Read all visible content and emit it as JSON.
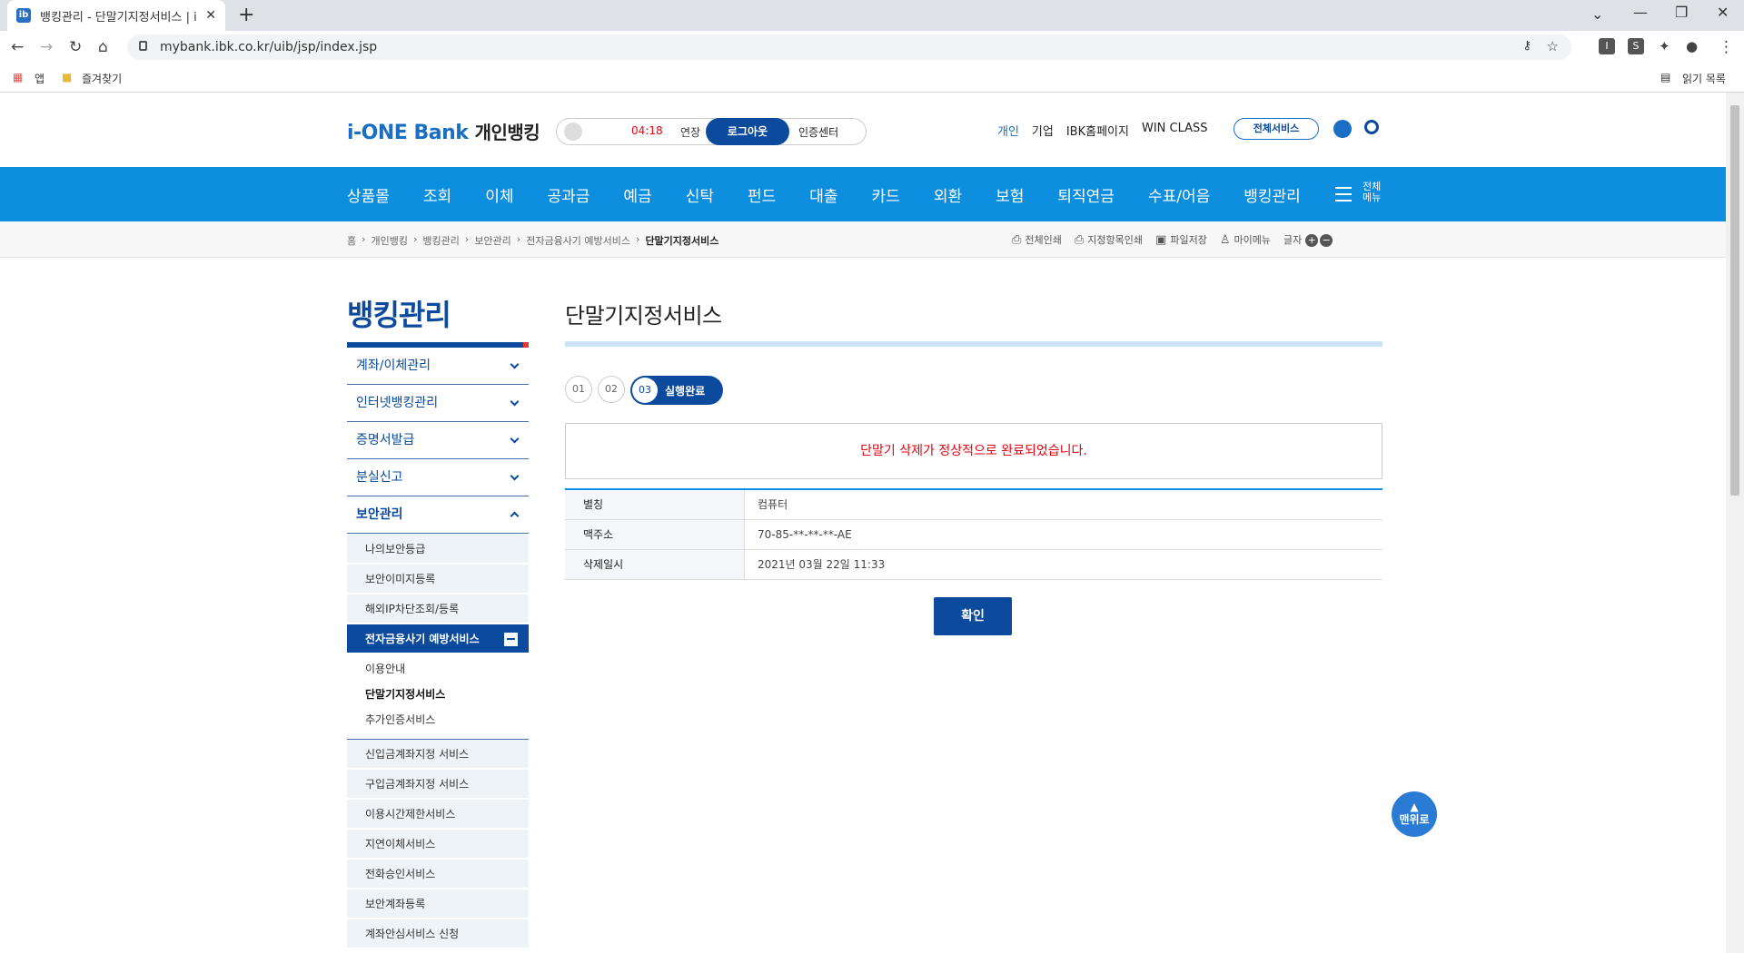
{
  "browser": {
    "tab_title": "뱅킹관리 - 단말기지정서비스 | i",
    "url": "mybank.ibk.co.kr/uib/jsp/index.jsp",
    "bookmarks": [
      "앱",
      "즐겨찾기"
    ],
    "reading_list": "읽기 목록",
    "ext_labels": [
      "I",
      "S"
    ]
  },
  "header": {
    "logo_brand": "i-ONE Bank",
    "logo_sub": "개인뱅킹",
    "timer": "04:18",
    "extend": "연장",
    "logout": "로그아웃",
    "cert_center": "인증센터",
    "top_nav": [
      "개인",
      "기업",
      "IBK홈페이지",
      "WIN CLASS"
    ],
    "all_services": "전체서비스"
  },
  "gnb": {
    "items": [
      "상품몰",
      "조회",
      "이체",
      "공과금",
      "예금",
      "신탁",
      "펀드",
      "대출",
      "카드",
      "외환",
      "보험",
      "퇴직연금",
      "수표/어음",
      "뱅킹관리"
    ],
    "all_menu": "전체\n메뉴"
  },
  "breadcrumb": [
    "홈",
    "개인뱅킹",
    "뱅킹관리",
    "보안관리",
    "전자금융사기 예방서비스",
    "단말기지정서비스"
  ],
  "utility": [
    "전체인쇄",
    "지정항목인쇄",
    "파일저장",
    "마이메뉴",
    "글자"
  ],
  "lnb": {
    "title": "뱅킹관리",
    "level1": [
      "계좌/이체관리",
      "인터넷뱅킹관리",
      "증명서발급",
      "분실신고",
      "보안관리"
    ],
    "level2_before": [
      "나의보안등급",
      "보안이미지등록",
      "해외IP차단조회/등록"
    ],
    "selected": "전자금융사기 예방서비스",
    "level3": [
      "이용안내",
      "단말기지정서비스",
      "추가인증서비스"
    ],
    "level2_after": [
      "신입금계좌지정 서비스",
      "구입금계좌지정 서비스",
      "이용시간제한서비스",
      "지연이체서비스",
      "전화승인서비스",
      "보안계좌등록",
      "계좌안심서비스 신청"
    ]
  },
  "main": {
    "title": "단말기지정서비스",
    "steps": [
      "01",
      "02",
      "03"
    ],
    "step_done_label": "실행완료",
    "message": "단말기 삭제가 정상적으로 완료되었습니다.",
    "table": [
      {
        "label": "별칭",
        "value": "컴퓨터"
      },
      {
        "label": "맥주소",
        "value": "70-85-**-**-**-AE"
      },
      {
        "label": "삭제일시",
        "value": "2021년 03월 22일 11:33"
      }
    ],
    "confirm": "확인",
    "to_top": "맨위로"
  },
  "colors": {
    "gnb_blue": "#0e8ede",
    "navy": "#0b4a9c",
    "alert_red": "#e8000f"
  }
}
